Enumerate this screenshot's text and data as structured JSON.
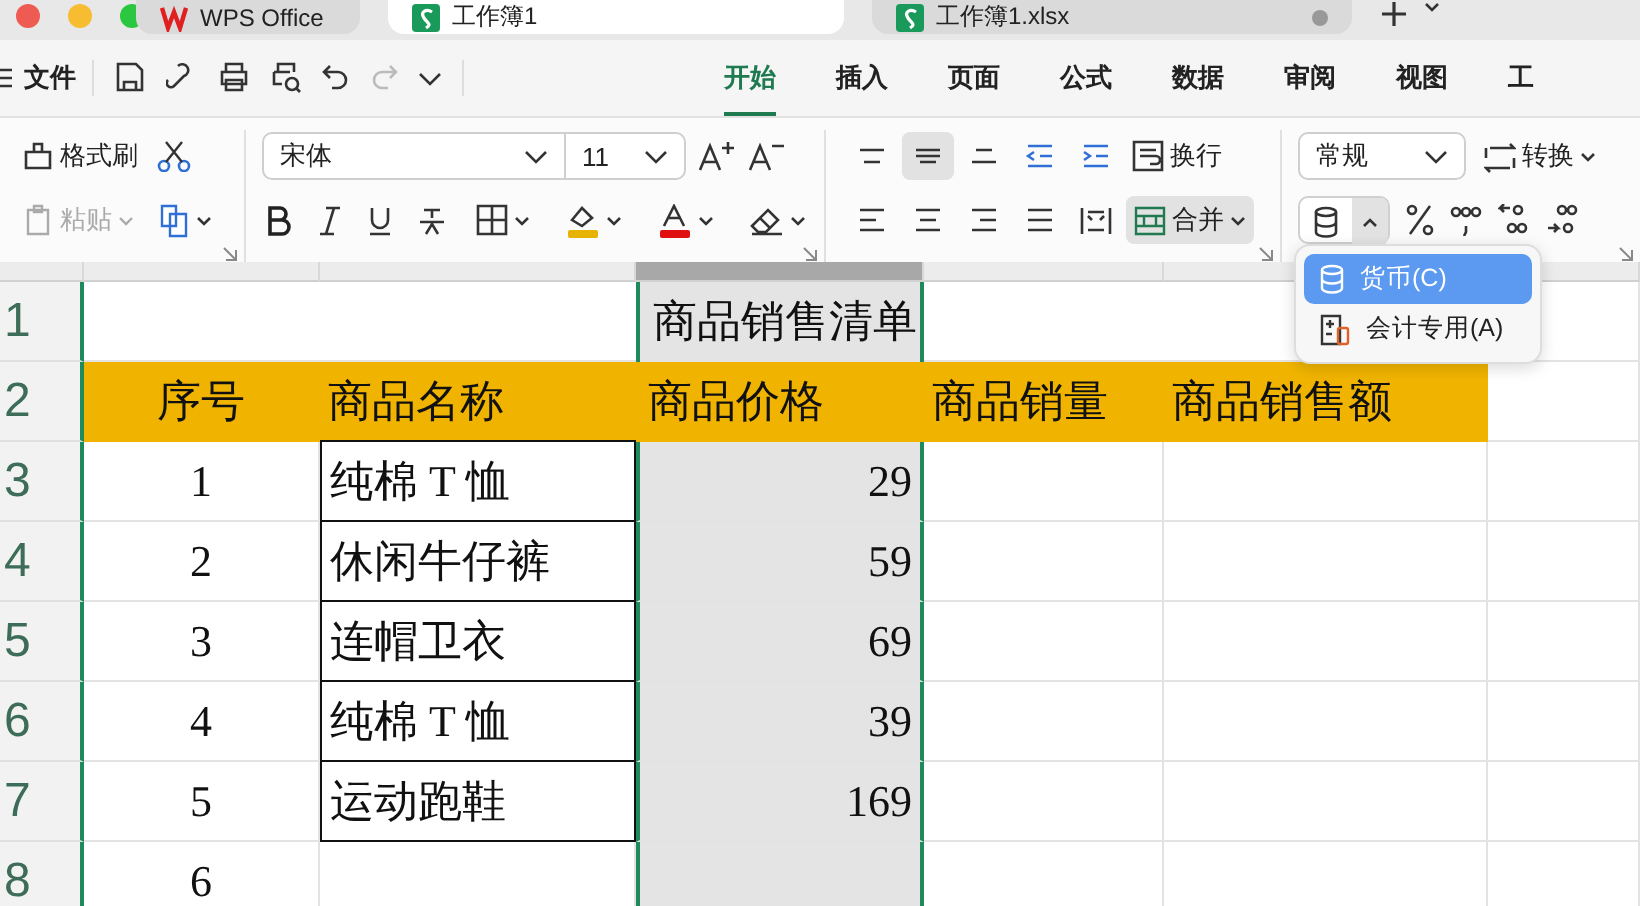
{
  "window_tabs": [
    {
      "kind": "wps",
      "label": "WPS Office",
      "selected": false
    },
    {
      "kind": "sheet",
      "label": "工作簿1",
      "selected": true
    },
    {
      "kind": "sheet",
      "label": "工作簿1.xlsx",
      "selected": false
    }
  ],
  "menu": {
    "file_label": "文件"
  },
  "ribbon_tabs": [
    {
      "label": "开始",
      "selected": true
    },
    {
      "label": "插入",
      "selected": false
    },
    {
      "label": "页面",
      "selected": false
    },
    {
      "label": "公式",
      "selected": false
    },
    {
      "label": "数据",
      "selected": false
    },
    {
      "label": "审阅",
      "selected": false
    },
    {
      "label": "视图",
      "selected": false
    },
    {
      "label": "工",
      "selected": false
    }
  ],
  "ribbon": {
    "format_painter": "格式刷",
    "paste": {
      "label": "粘贴",
      "disabled": true
    },
    "font": "宋体",
    "font_size": "11",
    "vertical_align": [
      {
        "kind": "top",
        "selected": false
      },
      {
        "kind": "middle",
        "selected": true
      },
      {
        "kind": "bottom",
        "selected": false
      }
    ],
    "wrap": "换行",
    "merge": {
      "label": "合并",
      "pressed": true
    },
    "number_format": "常规",
    "convert": "转换",
    "currency_menu": {
      "expanded": true
    }
  },
  "currency_dropdown": [
    {
      "kind": "currency",
      "label": "货币(C)",
      "selected": true
    },
    {
      "kind": "accounting",
      "label": "会计专用(A)",
      "selected": false
    }
  ],
  "sheet": {
    "row_numbers": [
      "1",
      "2",
      "3",
      "4",
      "5",
      "6",
      "7",
      "8"
    ],
    "title": "商品销售清单",
    "headers": [
      "序号",
      "商品名称",
      "商品价格",
      "商品销量",
      "商品销售额"
    ],
    "rows": [
      [
        "1",
        "纯棉 T 恤",
        "29"
      ],
      [
        "2",
        "休闲牛仔裤",
        "59"
      ],
      [
        "3",
        "连帽卫衣",
        "69"
      ],
      [
        "4",
        "纯棉 T 恤",
        "39"
      ],
      [
        "5",
        "运动跑鞋",
        "169"
      ],
      [
        "6",
        "",
        ""
      ]
    ]
  }
}
